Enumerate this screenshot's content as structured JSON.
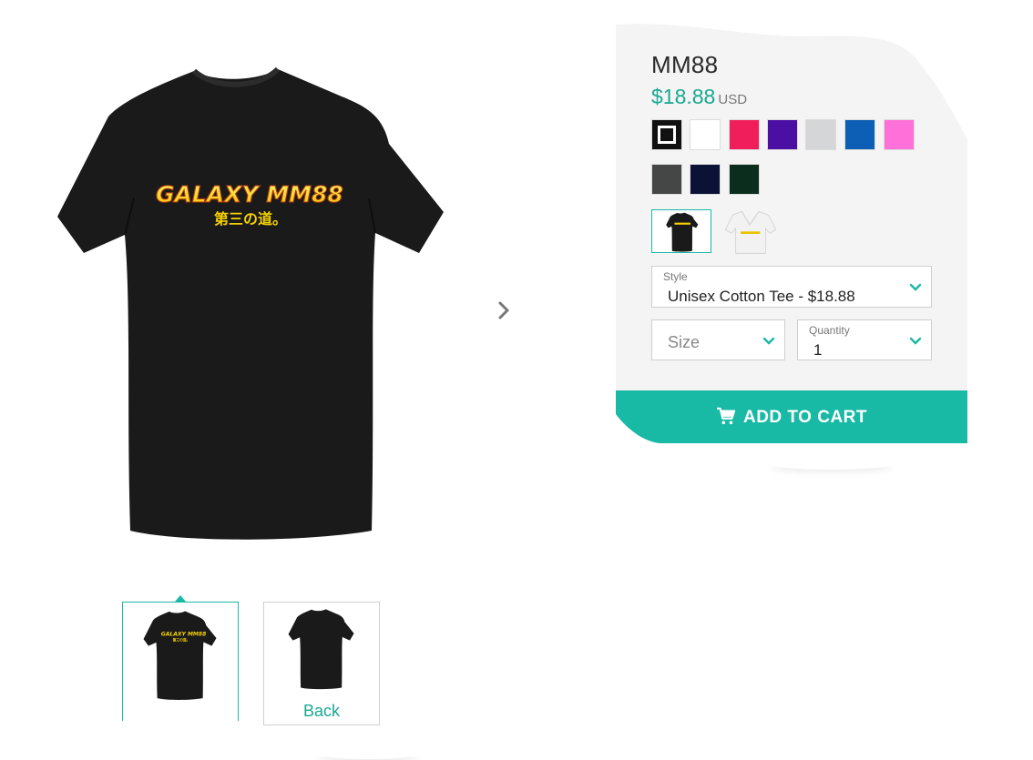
{
  "product": {
    "title": "MM88",
    "price": "$18.88",
    "currency": "USD",
    "print_line1": "GALAXY MM88",
    "print_line2": "第三の道。"
  },
  "colors": [
    {
      "name": "black",
      "hex": "#111111",
      "selected": true
    },
    {
      "name": "white",
      "hex": "#ffffff"
    },
    {
      "name": "pink",
      "hex": "#f01e5a"
    },
    {
      "name": "purple",
      "hex": "#4b0fa3"
    },
    {
      "name": "light-grey",
      "hex": "#d5d6d8"
    },
    {
      "name": "royal-blue",
      "hex": "#0c5fb4"
    },
    {
      "name": "hot-pink",
      "hex": "#ff70d8"
    },
    {
      "name": "charcoal",
      "hex": "#454747"
    },
    {
      "name": "navy",
      "hex": "#0b1235"
    },
    {
      "name": "forest-green",
      "hex": "#0b2d1d"
    }
  ],
  "style_select": {
    "label": "Style",
    "value": "Unisex Cotton Tee - $18.88"
  },
  "size_select": {
    "placeholder": "Size"
  },
  "quantity_select": {
    "label": "Quantity",
    "value": "1"
  },
  "cart_button": {
    "label": "ADD TO CART",
    "icon": "shopping-cart-icon"
  },
  "gallery": {
    "back_label": "Back",
    "next_icon": "chevron-right-icon"
  },
  "theme": {
    "accent": "#18b9a5",
    "price_color": "#18a892",
    "panel_bg": "#f4f4f4"
  }
}
